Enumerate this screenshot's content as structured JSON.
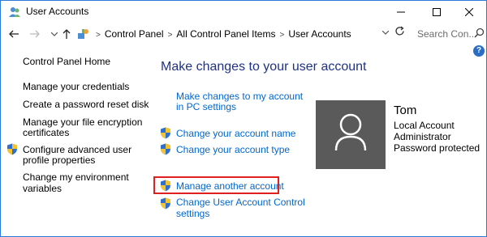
{
  "window": {
    "title": "User Accounts",
    "minimize_icon": "minimize-icon",
    "maximize_icon": "maximize-icon",
    "close_icon": "close-icon"
  },
  "address": {
    "breadcrumbs": [
      "Control Panel",
      "All Control Panel Items",
      "User Accounts"
    ],
    "search_placeholder": "Search Con..."
  },
  "sidebar": {
    "home": "Control Panel Home",
    "items": [
      {
        "line1": "Manage your credentials",
        "line2": ""
      },
      {
        "line1": "Create a password reset disk",
        "line2": ""
      },
      {
        "line1": "Manage your file encryption",
        "line2": "certificates"
      },
      {
        "line1": "Configure advanced user",
        "line2": "profile properties"
      },
      {
        "line1": "Change my environment",
        "line2": "variables"
      }
    ]
  },
  "main": {
    "heading": "Make changes to your user account",
    "links": [
      {
        "line1": "Make changes to my account",
        "line2": "in PC settings"
      },
      {
        "line1": "Change your account name",
        "line2": ""
      },
      {
        "line1": "Change your account type",
        "line2": ""
      },
      {
        "line1": "Manage another account",
        "line2": ""
      },
      {
        "line1": "Change User Account Control",
        "line2": "settings"
      }
    ]
  },
  "user": {
    "name": "Tom",
    "details": [
      "Local Account",
      "Administrator",
      "Password protected"
    ]
  },
  "colors": {
    "link": "#0066cc",
    "heading": "#1e3287",
    "highlight_border": "#e02020",
    "avatar_bg": "#5a5a5a"
  }
}
